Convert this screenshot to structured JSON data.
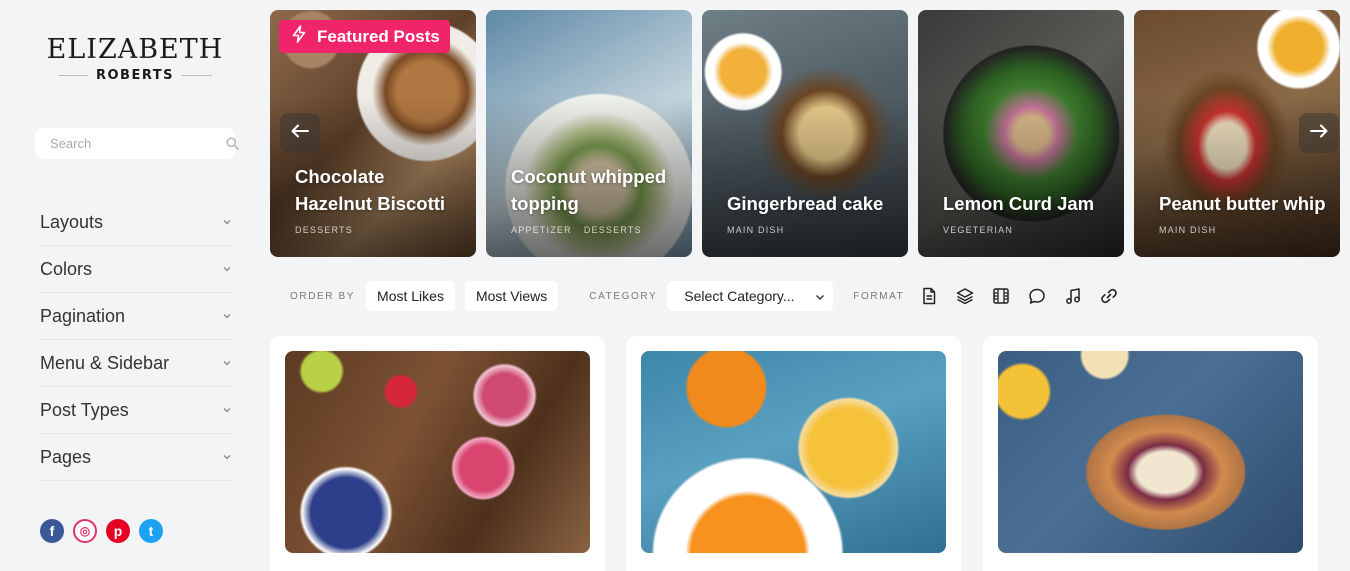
{
  "brand": {
    "name": "ELIZABETH",
    "subname": "ROBERTS"
  },
  "search": {
    "placeholder": "Search"
  },
  "menu": [
    {
      "label": "Layouts"
    },
    {
      "label": "Colors"
    },
    {
      "label": "Pagination"
    },
    {
      "label": "Menu & Sidebar"
    },
    {
      "label": "Post Types"
    },
    {
      "label": "Pages"
    }
  ],
  "social": [
    {
      "icon": "facebook-icon",
      "glyph": "f",
      "color": "#3b5998"
    },
    {
      "icon": "instagram-icon",
      "glyph": "◎",
      "color": "#e1306c"
    },
    {
      "icon": "pinterest-icon",
      "glyph": "p",
      "color": "#e60023"
    },
    {
      "icon": "twitter-icon",
      "glyph": "t",
      "color": "#1da1f2"
    }
  ],
  "featured": {
    "badge": "Featured Posts",
    "accent": "#f0246a",
    "slides": [
      {
        "title": "Chocolate Hazelnut Biscotti",
        "cats": [
          "DESSERTS"
        ]
      },
      {
        "title": "Coconut whipped topping",
        "cats": [
          "APPETIZER",
          "DESSERTS"
        ]
      },
      {
        "title": "Gingerbread cake",
        "cats": [
          "MAIN DISH"
        ]
      },
      {
        "title": "Lemon Curd Jam",
        "cats": [
          "VEGETERIAN"
        ]
      },
      {
        "title": "Peanut butter whip",
        "cats": [
          "MAIN DISH"
        ]
      }
    ]
  },
  "filters": {
    "order_label": "ORDER BY",
    "order_options": [
      "Most Likes",
      "Most Views"
    ],
    "category_label": "CATEGORY",
    "category_value": "Select Category...",
    "format_label": "FORMAT",
    "format_icons": [
      "document-icon",
      "layers-icon",
      "film-icon",
      "chat-bubble-icon",
      "music-note-icon",
      "link-icon"
    ]
  }
}
